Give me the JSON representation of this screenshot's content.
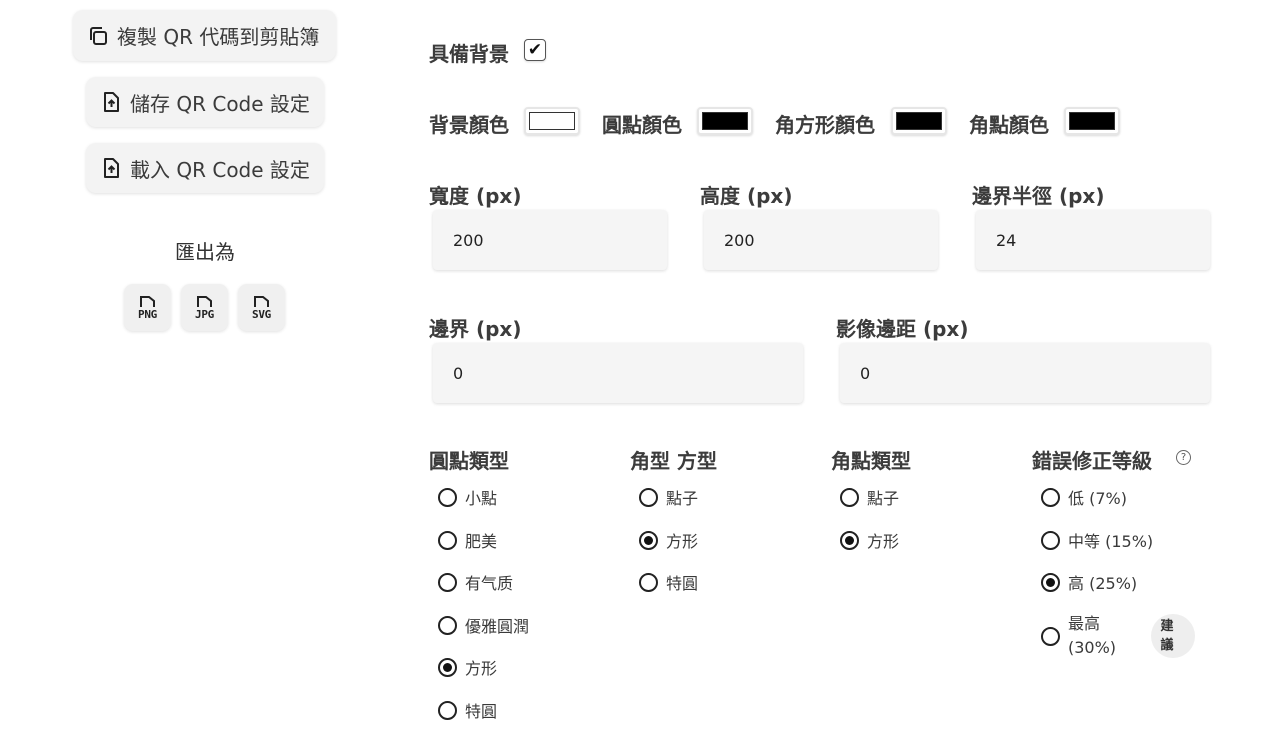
{
  "sidebar": {
    "copy_label": "複製 QR 代碼到剪貼簿",
    "save_label": "儲存 QR Code 設定",
    "load_label": "載入 QR Code 設定",
    "export_title": "匯出為",
    "export_formats": [
      "PNG",
      "JPG",
      "SVG"
    ]
  },
  "background": {
    "has_bg_label": "具備背景",
    "has_bg_checked": true,
    "check_glyph": "✔"
  },
  "colors": {
    "bg_label": "背景顏色",
    "bg_value": "#ffffff",
    "dot_label": "圓點顏色",
    "dot_value": "#000000",
    "corner_square_label": "角方形顏色",
    "corner_square_value": "#000000",
    "corner_dot_label": "角點顏色",
    "corner_dot_value": "#000000"
  },
  "dimensions": {
    "width_label": "寬度 (px)",
    "width_value": "200",
    "height_label": "高度 (px)",
    "height_value": "200",
    "radius_label": "邊界半徑 (px)",
    "radius_value": "24",
    "border_label": "邊界 (px)",
    "border_value": "0",
    "margin_label": "影像邊距 (px)",
    "margin_value": "0"
  },
  "dot_type": {
    "title": "圓點類型",
    "options": [
      "小點",
      "肥美",
      "有气质",
      "優雅圓潤",
      "方形",
      "特圓"
    ],
    "selected": 4
  },
  "corner_square_type": {
    "title": "角型 方型",
    "options": [
      "點子",
      "方形",
      "特圓"
    ],
    "selected": 1
  },
  "corner_dot_type": {
    "title": "角點類型",
    "options": [
      "點子",
      "方形"
    ],
    "selected": 1
  },
  "error_correction": {
    "title": "錯誤修正等級",
    "help_glyph": "?",
    "options": [
      "低 (7%)",
      "中等 (15%)",
      "高 (25%)"
    ],
    "highest_line1": "最高",
    "highest_line2": "(30%)",
    "recommend_line1": "建",
    "recommend_line2": "議",
    "selected": 2
  }
}
